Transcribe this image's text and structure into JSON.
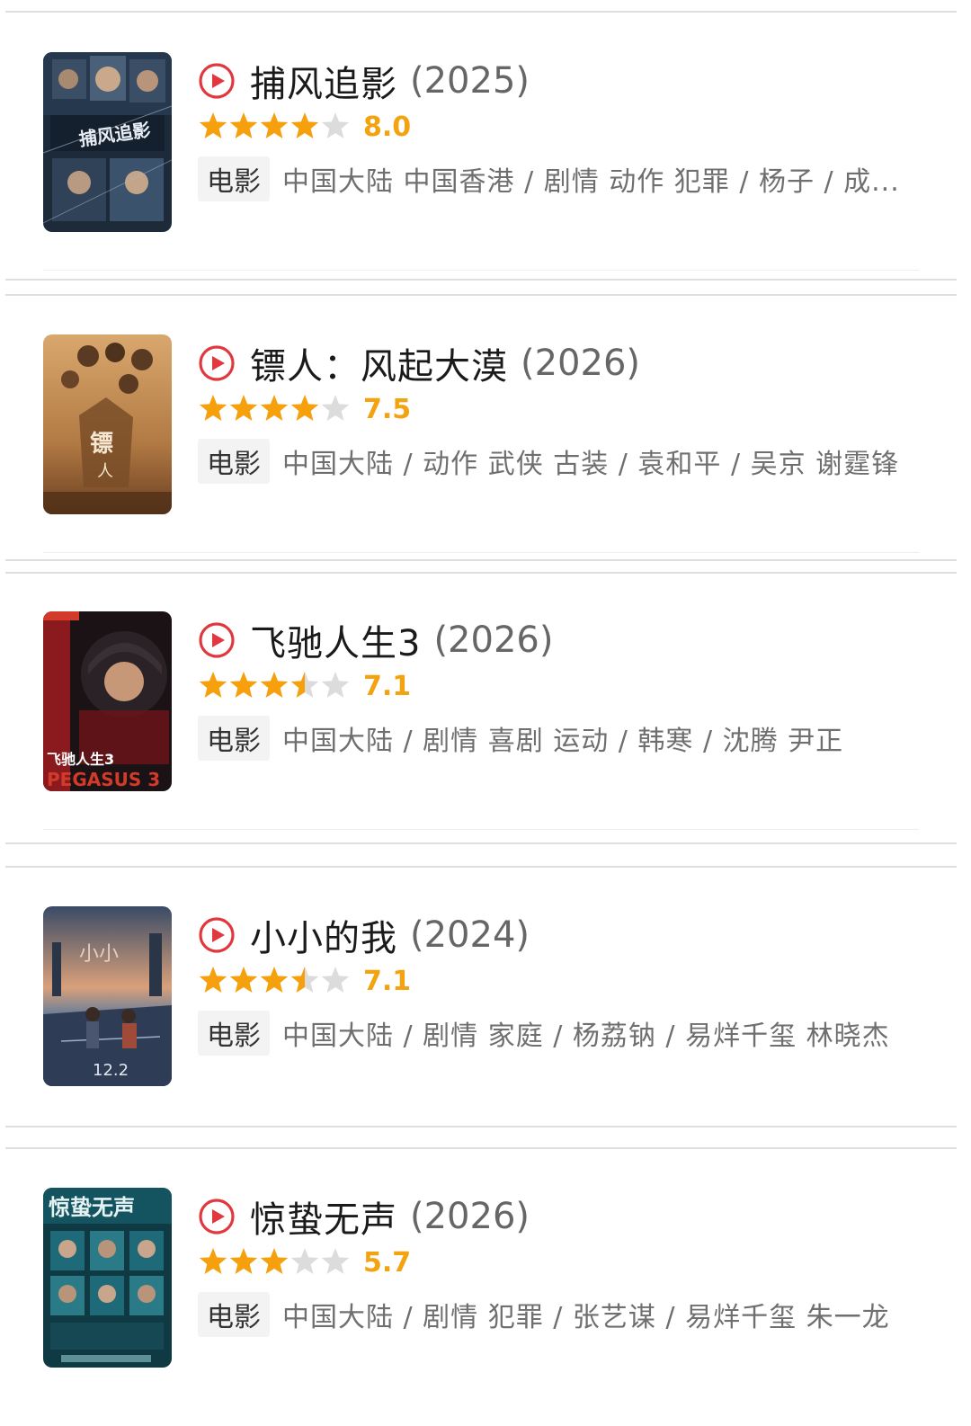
{
  "colors": {
    "play_icon": "#e0383e",
    "star_filled": "#f5a00c",
    "star_empty": "#dcdcdc",
    "score": "#f2a30f",
    "tag_bg": "#f3f3f3",
    "divider": "#dedede"
  },
  "movies": [
    {
      "title": "捕风追影",
      "year": "(2025)",
      "stars": 4,
      "score": "8.0",
      "tag": "电影",
      "info": "中国大陆 中国香港 / 剧情 动作 犯罪 / 杨子 / 成...",
      "poster_colors": [
        "#1d2a3a",
        "#3a4e66",
        "#a8b7c7"
      ]
    },
    {
      "title": "镖人：风起大漠",
      "year": "(2026)",
      "stars": 4,
      "score": "7.5",
      "tag": "电影",
      "info": "中国大陆 / 动作 武侠 古装 / 袁和平 / 吴京 谢霆锋",
      "poster_colors": [
        "#c08a52",
        "#e2b27c",
        "#6b4020"
      ]
    },
    {
      "title": "飞驰人生3",
      "year": "(2026)",
      "stars": 3.5,
      "score": "7.1",
      "tag": "电影",
      "info": "中国大陆 / 剧情 喜剧 运动 / 韩寒 / 沈腾 尹正",
      "poster_colors": [
        "#1a1214",
        "#7a1a1e",
        "#d23a2a"
      ]
    },
    {
      "title": "小小的我",
      "year": "(2024)",
      "stars": 3.5,
      "score": "7.1",
      "tag": "电影",
      "info": "中国大陆 / 剧情 家庭 / 杨荔钠 / 易烊千玺 林晓杰",
      "poster_colors": [
        "#2e3d55",
        "#6b7f98",
        "#d9a07a"
      ]
    },
    {
      "title": "惊蛰无声",
      "year": "(2026)",
      "stars": 3,
      "score": "5.7",
      "tag": "电影",
      "info": "中国大陆 / 剧情 犯罪 / 张艺谋 / 易烊千玺 朱一龙",
      "poster_colors": [
        "#0f3a44",
        "#1f6a78",
        "#7fb5bd"
      ]
    }
  ]
}
